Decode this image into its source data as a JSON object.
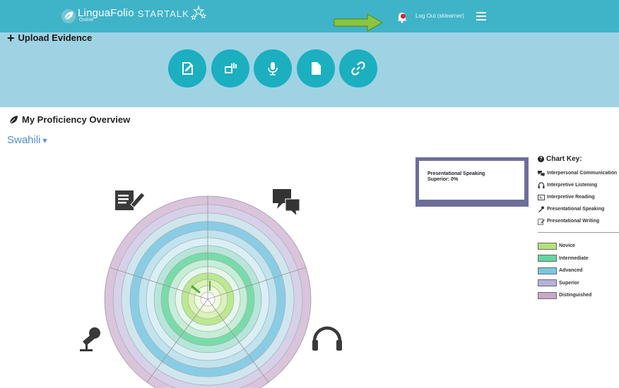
{
  "header": {
    "brand": "LinguaFolio",
    "brand_sub": "Online",
    "partner": "STARTALK",
    "logout": "Log Out (sklearner)",
    "bar_color": "#3fb3c8"
  },
  "upload": {
    "title": "Upload Evidence",
    "panel_color": "#9fd3e3",
    "button_color": "#1bafc0",
    "buttons": [
      {
        "name": "upload-writing-button",
        "icon": "edit-document-icon"
      },
      {
        "name": "upload-reading-button",
        "icon": "image-text-icon"
      },
      {
        "name": "upload-audio-button",
        "icon": "microphone-icon"
      },
      {
        "name": "upload-file-button",
        "icon": "file-icon"
      },
      {
        "name": "upload-link-button",
        "icon": "link-icon"
      }
    ]
  },
  "proficiency": {
    "title": "My Proficiency Overview",
    "language": "Swahili",
    "tooltip": {
      "line1": "Presentational Speaking",
      "line2": "Superior: 0%"
    },
    "wheel_icons": [
      "presentational-writing-icon",
      "interpersonal-communication-icon",
      "presentational-speaking-icon",
      "interpretive-listening-icon"
    ]
  },
  "chart_key": {
    "title": "Chart Key:",
    "modes": [
      {
        "label": "Interpersonal Communication",
        "icon": "chat-bubbles-icon"
      },
      {
        "label": "Interpretive Listening",
        "icon": "headphones-icon"
      },
      {
        "label": "Interpretive Reading",
        "icon": "reading-icon"
      },
      {
        "label": "Presentational Speaking",
        "icon": "microphone-icon"
      },
      {
        "label": "Presentational Writing",
        "icon": "writing-icon"
      }
    ],
    "levels": [
      {
        "label": "Novice",
        "color": "#b5e07e"
      },
      {
        "label": "Intermediate",
        "color": "#63d6a0"
      },
      {
        "label": "Advanced",
        "color": "#7bc6e0"
      },
      {
        "label": "Superior",
        "color": "#b7b1d9"
      },
      {
        "label": "Distinguished",
        "color": "#c9a7c8"
      }
    ]
  }
}
